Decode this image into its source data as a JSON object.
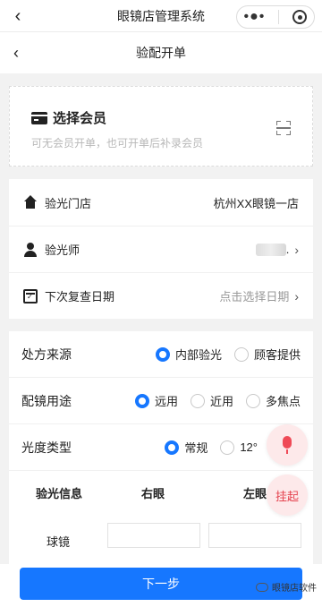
{
  "wechat": {
    "title": "眼镜店管理系统",
    "back_icon": "chevron-left-icon",
    "more_icon": "more-dots-icon",
    "close_icon": "target-icon"
  },
  "header": {
    "title": "验配开单"
  },
  "member": {
    "title": "选择会员",
    "hint": "可无会员开单，也可开单后补录会员"
  },
  "info": {
    "store": {
      "label": "验光门店",
      "value": "杭州XX眼镜一店"
    },
    "optometrist": {
      "label": "验光师",
      "value": "."
    },
    "recheck": {
      "label": "下次复查日期",
      "placeholder": "点击选择日期"
    }
  },
  "prescription": {
    "source": {
      "label": "处方来源",
      "options": [
        "内部验光",
        "顾客提供"
      ],
      "selected": 0
    },
    "usage": {
      "label": "配镜用途",
      "options": [
        "远用",
        "近用",
        "多焦点"
      ],
      "selected": 0
    },
    "power_type": {
      "label": "光度类型",
      "options": [
        "常规",
        "12°"
      ],
      "selected": 0
    },
    "table": {
      "headers": [
        "验光信息",
        "右眼",
        "左眼"
      ],
      "rows": [
        {
          "label": "球镜",
          "right": "",
          "left": ""
        }
      ]
    }
  },
  "fab": {
    "voice_icon": "microphone-icon",
    "hang_label": "挂起"
  },
  "footer": {
    "next_label": "下一步"
  },
  "watermark": {
    "text": "眼镜店软件"
  },
  "colors": {
    "accent": "#1677ff",
    "fab_bg": "#fde9ea",
    "fab_fg": "#ef4a57"
  }
}
